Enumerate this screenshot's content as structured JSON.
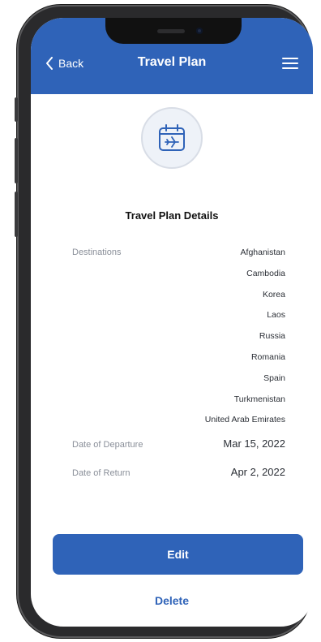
{
  "header": {
    "back_label": "Back",
    "title": "Travel Plan"
  },
  "plan": {
    "heading": "Travel Plan Details",
    "destinations_label": "Destinations",
    "destinations": [
      "Afghanistan",
      "Cambodia",
      "Korea",
      "Laos",
      "Russia",
      "Romania",
      "Spain",
      "Turkmenistan",
      "United Arab Emirates"
    ],
    "departure_label": "Date of Departure",
    "departure_value": "Mar 15, 2022",
    "return_label": "Date of Return",
    "return_value": "Apr 2, 2022"
  },
  "actions": {
    "edit_label": "Edit",
    "delete_label": "Delete"
  },
  "colors": {
    "accent": "#2f63b8",
    "label": "#8a8f99",
    "text": "#2b2f36"
  },
  "icons": {
    "back": "chevron-left-icon",
    "menu": "hamburger-icon",
    "plan": "calendar-plane-icon"
  }
}
